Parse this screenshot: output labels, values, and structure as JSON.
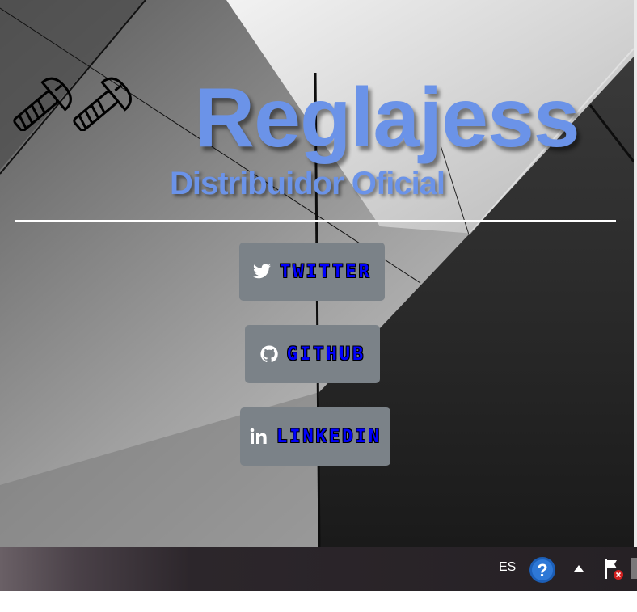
{
  "brand": {
    "title": "Reglajess",
    "tagline": "Distribuidor Oficial",
    "color": "#6b93e8",
    "logo_icon": "screws-icon"
  },
  "buttons": [
    {
      "id": "twitter",
      "label": "TWITTER",
      "icon": "twitter-icon"
    },
    {
      "id": "github",
      "label": "GITHUB",
      "icon": "github-icon"
    },
    {
      "id": "linkedin",
      "label": "LINKEDIN",
      "icon": "linkedin-icon"
    }
  ],
  "button_style": {
    "background": "#7b8288",
    "label_color": "#0000ff"
  },
  "taskbar": {
    "language": "ES",
    "icons": [
      "help-icon",
      "show-hidden-icons-arrow",
      "action-center-flag-icon"
    ]
  }
}
